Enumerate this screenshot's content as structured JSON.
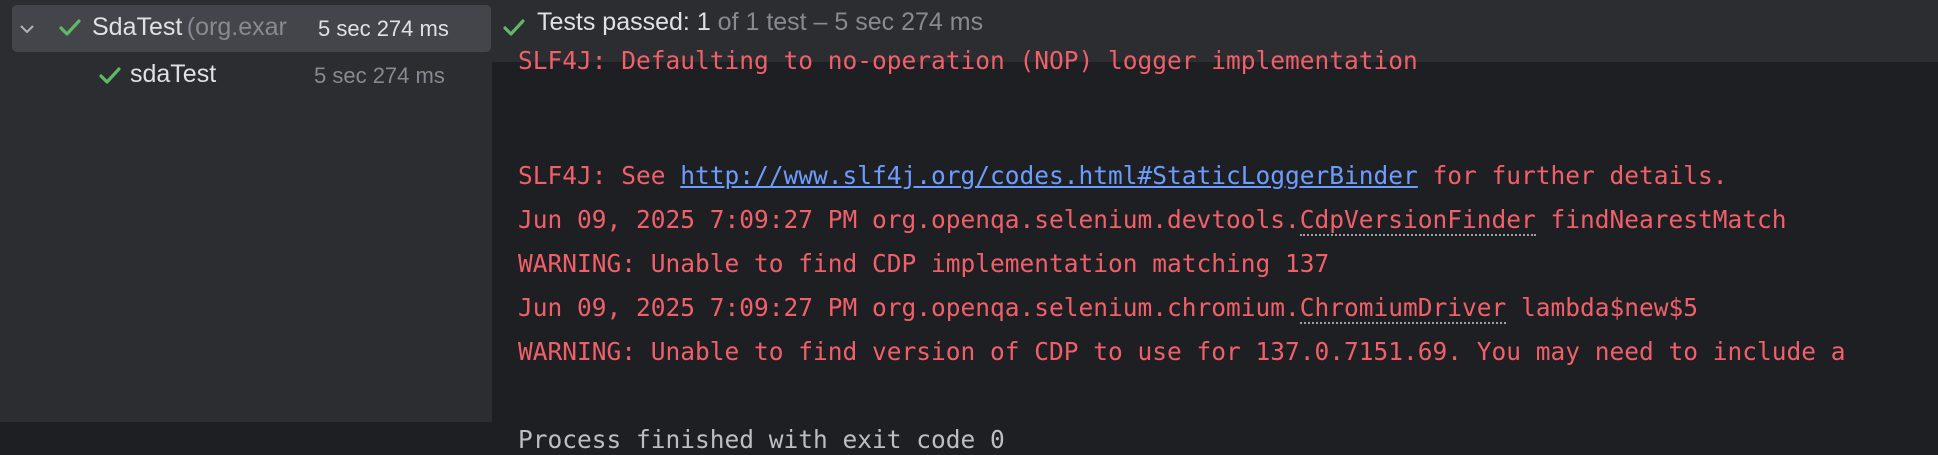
{
  "test_tree": {
    "suite": {
      "name": "SdaTest",
      "package": "(org.exar",
      "time": "5 sec 274 ms",
      "status": "passed"
    },
    "tests": [
      {
        "name": "sdaTest",
        "time": "5 sec 274 ms",
        "status": "passed"
      }
    ]
  },
  "status_bar": {
    "label": "Tests passed:",
    "count": "1",
    "detail": "of 1 test – 5 sec 274 ms"
  },
  "log": {
    "line0": "SLF4J: Defaulting to no-operation (NOP) logger implementation",
    "line1_prefix": "SLF4J: See ",
    "line1_link": "http://www.slf4j.org/codes.html#StaticLoggerBinder",
    "line1_suffix": " for further details.",
    "line2_prefix": "Jun 09, 2025 7:09:27 PM org.openqa.selenium.devtools.",
    "line2_class": "CdpVersionFinder",
    "line2_suffix": " findNearestMatch",
    "line3": "WARNING: Unable to find CDP implementation matching 137",
    "line4_prefix": "Jun 09, 2025 7:09:27 PM org.openqa.selenium.chromium.",
    "line4_class": "ChromiumDriver",
    "line4_suffix": " lambda$new$5",
    "line5": "WARNING: Unable to find version of CDP to use for 137.0.7151.69. You may need to include a",
    "line7": "Process finished with exit code 0"
  },
  "colors": {
    "pass_green": "#5fb865",
    "error_red": "#f0606a",
    "link_blue": "#6d9cff"
  }
}
